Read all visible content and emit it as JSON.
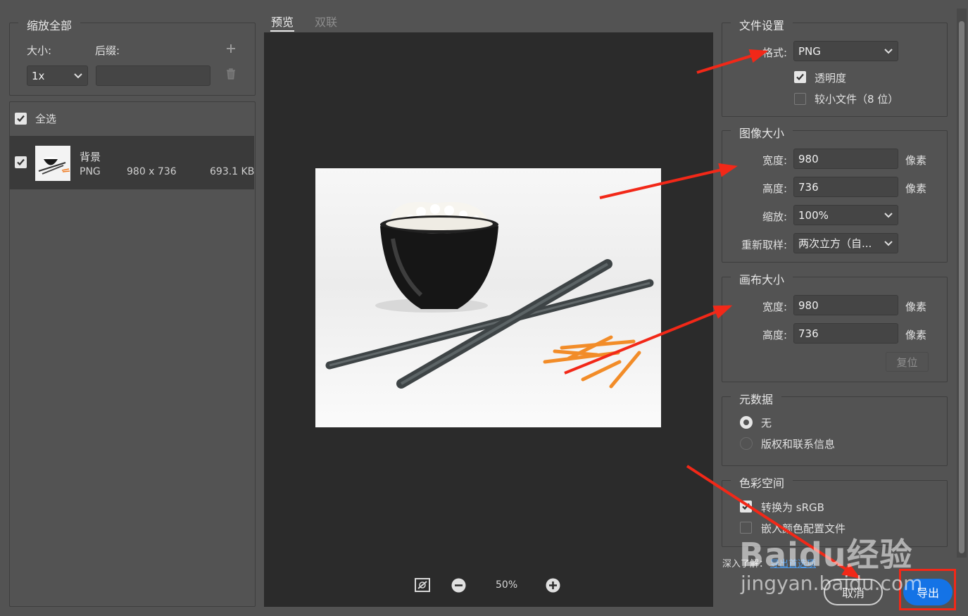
{
  "left": {
    "scale_title": "缩放全部",
    "size_label": "大小:",
    "suffix_label": "后缀:",
    "size_value": "1x",
    "suffix_value": "",
    "add_icon": "plus-icon",
    "delete_icon": "trash-icon",
    "select_all_label": "全选",
    "layer": {
      "name": "背景",
      "format": "PNG",
      "dimensions": "980 x 736",
      "filesize": "693.1 KB"
    }
  },
  "preview": {
    "tabs": [
      "预览",
      "双联"
    ],
    "zoom": "50%",
    "icons": [
      "fit-screen-icon",
      "zoom-out-icon",
      "zoom-in-icon"
    ]
  },
  "right": {
    "file_settings": {
      "title": "文件设置",
      "format_label": "格式:",
      "format_value": "PNG",
      "transparency_label": "透明度",
      "transparency_checked": true,
      "smaller_file_label": "较小文件（8 位）",
      "smaller_file_checked": false
    },
    "image_size": {
      "title": "图像大小",
      "width_label": "宽度:",
      "width_value": "980",
      "height_label": "高度:",
      "height_value": "736",
      "unit": "像素",
      "scale_label": "缩放:",
      "scale_value": "100%",
      "resample_label": "重新取样:",
      "resample_value": "两次立方（自..."
    },
    "canvas_size": {
      "title": "画布大小",
      "width_label": "宽度:",
      "width_value": "980",
      "height_label": "高度:",
      "height_value": "736",
      "unit": "像素",
      "reset_label": "复位"
    },
    "metadata": {
      "title": "元数据",
      "none_label": "无",
      "copyright_label": "版权和联系信息",
      "selected": "none"
    },
    "color_space": {
      "title": "色彩空间",
      "convert_label": "转换为 sRGB",
      "convert_checked": true,
      "embed_label": "嵌入颜色配置文件",
      "embed_checked": false
    },
    "learn_more_label": "深入了解：",
    "learn_more_link": "导出首选项"
  },
  "footer": {
    "cancel_label": "取消",
    "export_label": "导出"
  },
  "watermark": {
    "logo_text": "Baidu经验",
    "url_text": "jingyan.baidu.com"
  },
  "colors": {
    "background": "#535353",
    "preview_bg": "#2b2b2b",
    "selected_row": "#3a3a3a",
    "export_button": "#1473e6",
    "annotation_red": "#f22818"
  }
}
